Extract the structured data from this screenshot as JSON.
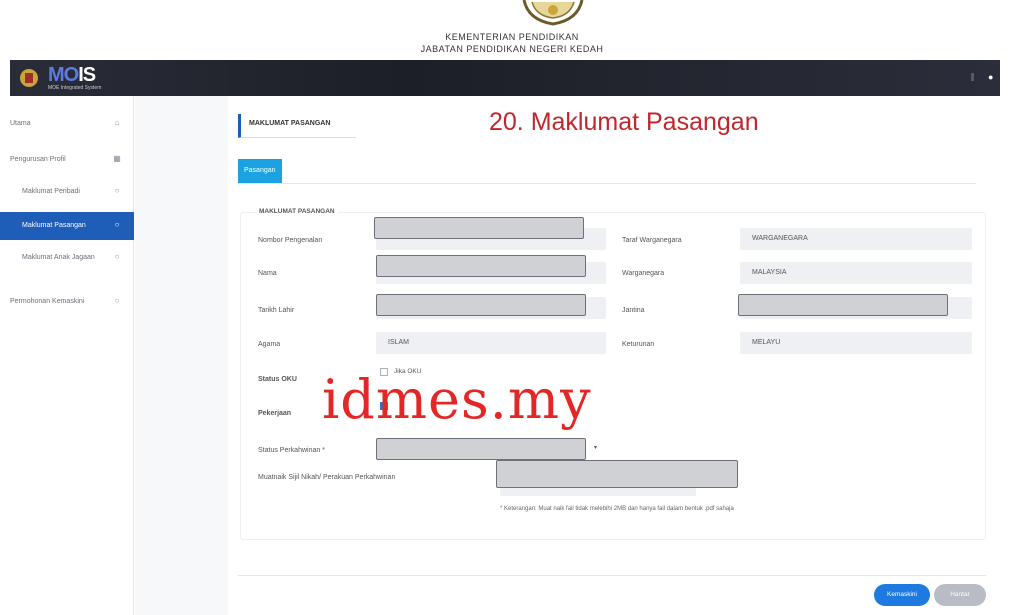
{
  "ministry": {
    "line1": "KEMENTERIAN PENDIDIKAN",
    "line2": "JABATAN PENDIDIKAN NEGERI KEDAH"
  },
  "topbar": {
    "logo_prefix": "MO",
    "logo_suffix": "IS",
    "logo_subtitle": "MOE Integrated System"
  },
  "sidebar": {
    "items": [
      {
        "label": "Utama",
        "icon": "home-icon",
        "glyph": "⌂"
      },
      {
        "label": "Pengurusan Profil",
        "icon": "grid-icon",
        "glyph": "▦"
      },
      {
        "label": "Maklumat Peribadi",
        "icon": "circle-icon",
        "glyph": "○"
      },
      {
        "label": "Maklumat Pasangan",
        "icon": "circle-icon",
        "glyph": "○"
      },
      {
        "label": "Maklumat Anak Jagaan",
        "icon": "circle-icon",
        "glyph": "○"
      },
      {
        "label": "Permohonan Kemaskini",
        "icon": "circle-icon",
        "glyph": "○"
      }
    ],
    "active_index": 3
  },
  "main": {
    "section_title": "MAKLUMAT PASANGAN",
    "overlay_heading": "20. Maklumat Pasangan",
    "tab_label": "Pasangan",
    "fieldset_legend": "MAKLUMAT PASANGAN",
    "fields_left": [
      {
        "label": "Nombor Pengenalan",
        "value": ""
      },
      {
        "label": "Nama",
        "value": ""
      },
      {
        "label": "Tarikh Lahir",
        "value": ""
      },
      {
        "label": "Agama",
        "value": "ISLAM"
      }
    ],
    "fields_right": [
      {
        "label": "Taraf Warganegara",
        "value": "WARGANEGARA"
      },
      {
        "label": "Warganegara",
        "value": "MALAYSIA"
      },
      {
        "label": "Jantina",
        "value": ""
      },
      {
        "label": "Keturunan",
        "value": "MELAYU"
      }
    ],
    "status_oku_label": "Status OKU",
    "oku_checkbox_label": "Jika OKU",
    "pekerjaan_label": "Pekerjaan",
    "status_perkahwinan_label": "Status Perkahwinan *",
    "muatnaik_label": "Muatnaik Sijil Nikah/ Perakuan Perkahwinan",
    "note": "* Keterangan: Muat naik fail tidak melebihi 2MB dan hanya fail dalam bentuk .pdf sahaja",
    "watermark": "idmes.my",
    "save_label": "Kemaskini",
    "submit_label": "Hantar"
  },
  "colors": {
    "accent": "#1e5db8",
    "tab": "#1aa3e0",
    "heading_red": "#c0272d",
    "watermark_red": "#e32727"
  }
}
